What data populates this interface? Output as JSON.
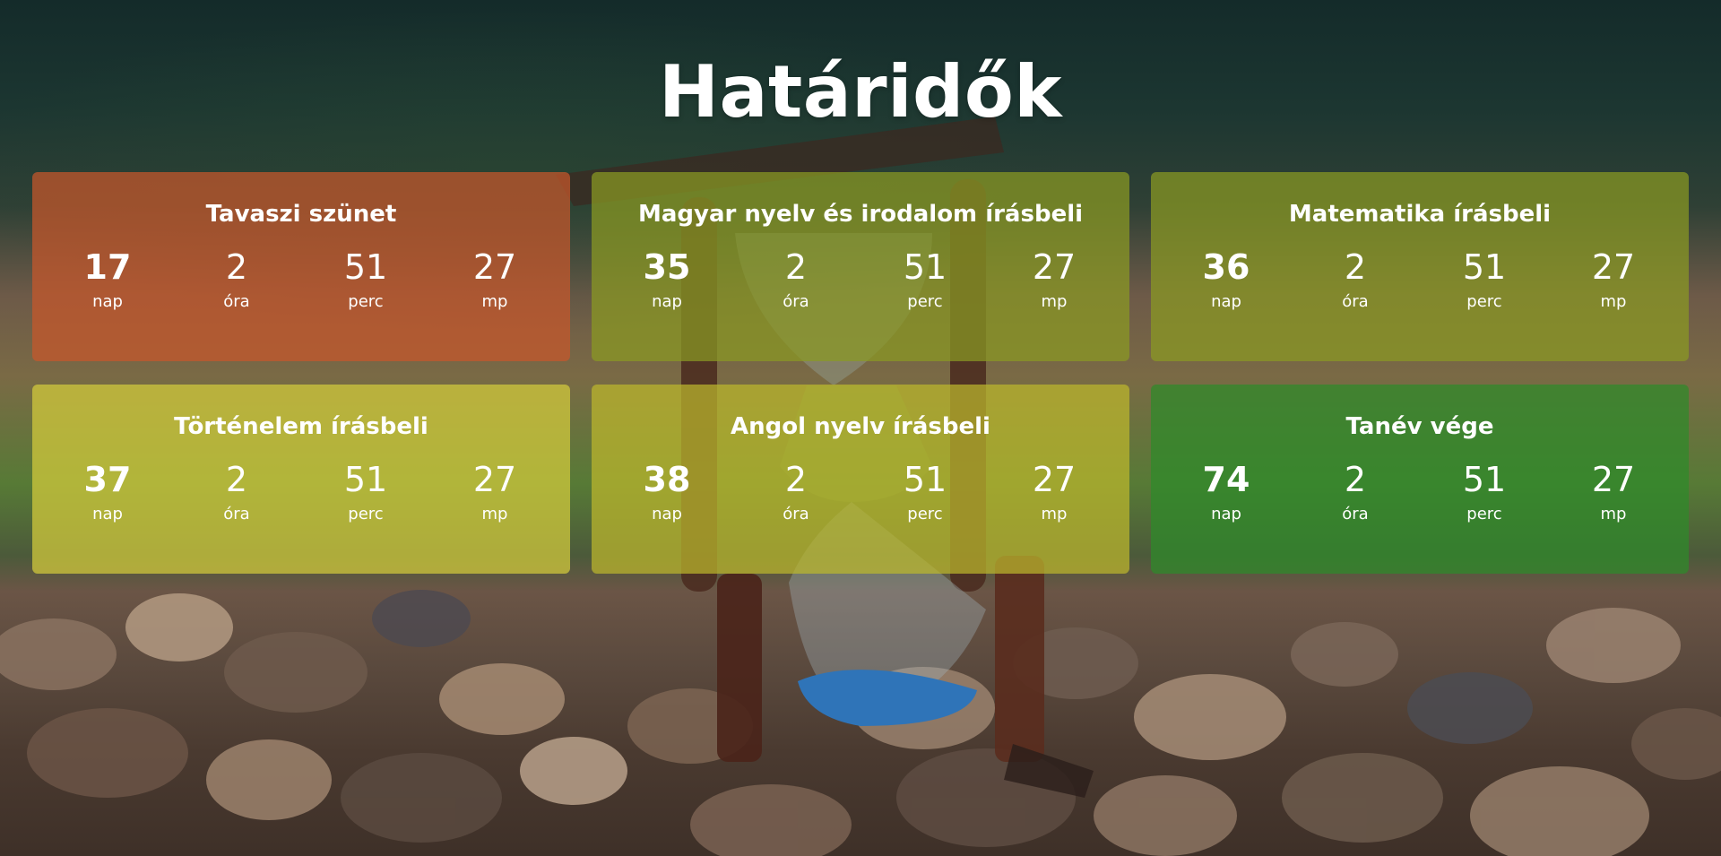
{
  "page": {
    "title": "Határidők"
  },
  "labels": {
    "days": "nap",
    "hours": "óra",
    "minutes": "perc",
    "seconds": "mp"
  },
  "cards": [
    {
      "title": "Tavaszi szünet",
      "days": "17",
      "hours": "2",
      "minutes": "51",
      "seconds": "27",
      "color": "#c8582b"
    },
    {
      "title": "Magyar nyelv és irodalom írásbeli",
      "days": "35",
      "hours": "2",
      "minutes": "51",
      "seconds": "27",
      "color": "#8a9a22"
    },
    {
      "title": "Matematika írásbeli",
      "days": "36",
      "hours": "2",
      "minutes": "51",
      "seconds": "27",
      "color": "#8a9a22"
    },
    {
      "title": "Történelem írásbeli",
      "days": "37",
      "hours": "2",
      "minutes": "51",
      "seconds": "27",
      "color": "#d4cc3c"
    },
    {
      "title": "Angol nyelv írásbeli",
      "days": "38",
      "hours": "2",
      "minutes": "51",
      "seconds": "27",
      "color": "#bdb72c"
    },
    {
      "title": "Tanév vége",
      "days": "74",
      "hours": "2",
      "minutes": "51",
      "seconds": "27",
      "color": "#2e8a2a"
    }
  ]
}
